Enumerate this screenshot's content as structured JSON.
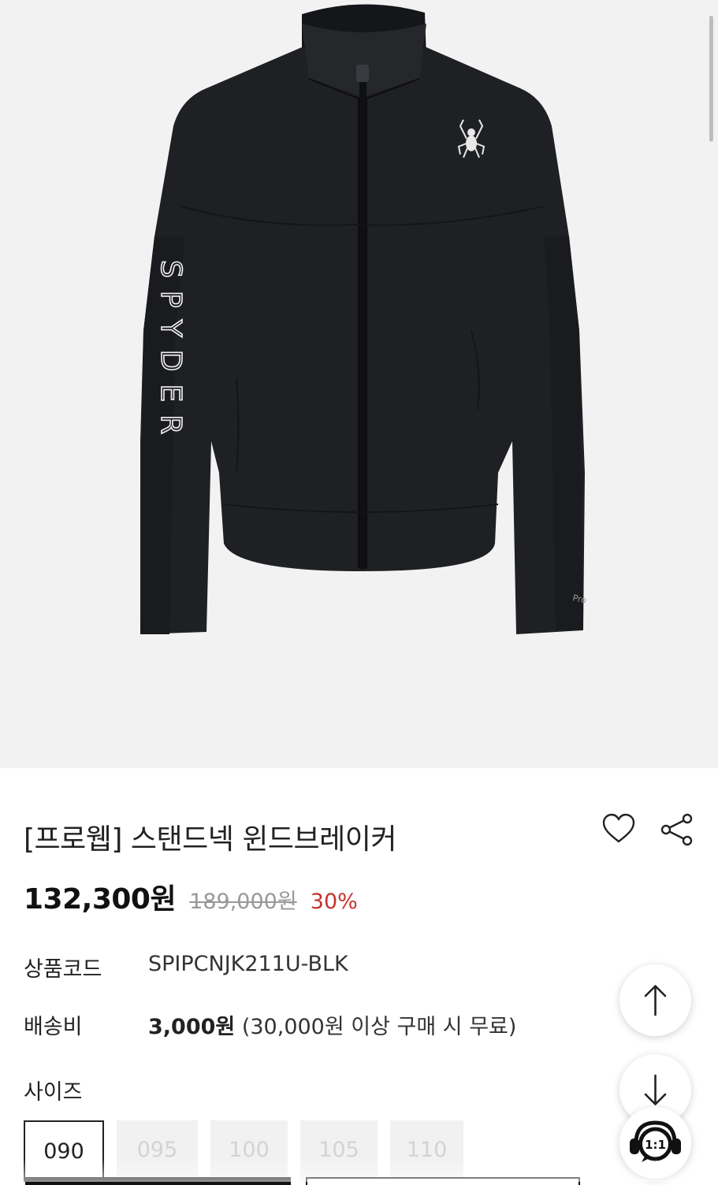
{
  "product": {
    "title": "[프로웹] 스탠드넥 윈드브레이커",
    "sale_price": "132,300원",
    "original_price": "189,000원",
    "discount_rate": "30%"
  },
  "info": {
    "code_label": "상품코드",
    "code_value": "SPIPCNJK211U-BLK",
    "shipping_label": "배송비",
    "shipping_fee": "3,000원",
    "shipping_note": "(30,000원 이상 구매 시 무료)"
  },
  "size": {
    "label": "사이즈",
    "options": [
      "090",
      "095",
      "100",
      "105",
      "110"
    ],
    "selected": "090"
  },
  "chat": {
    "label": "1:1"
  },
  "image": {
    "sleeve_text": "SPYDER",
    "cuff_text": "Pro"
  },
  "icons": {
    "wishlist": "heart-icon",
    "share": "share-icon",
    "scroll_up": "arrow-up-icon",
    "scroll_down": "arrow-down-icon",
    "chat": "headset-chat-icon"
  },
  "colors": {
    "discount": "#c8322b",
    "jacket": "#1f2023",
    "hero_background": "#f2f2f2"
  }
}
